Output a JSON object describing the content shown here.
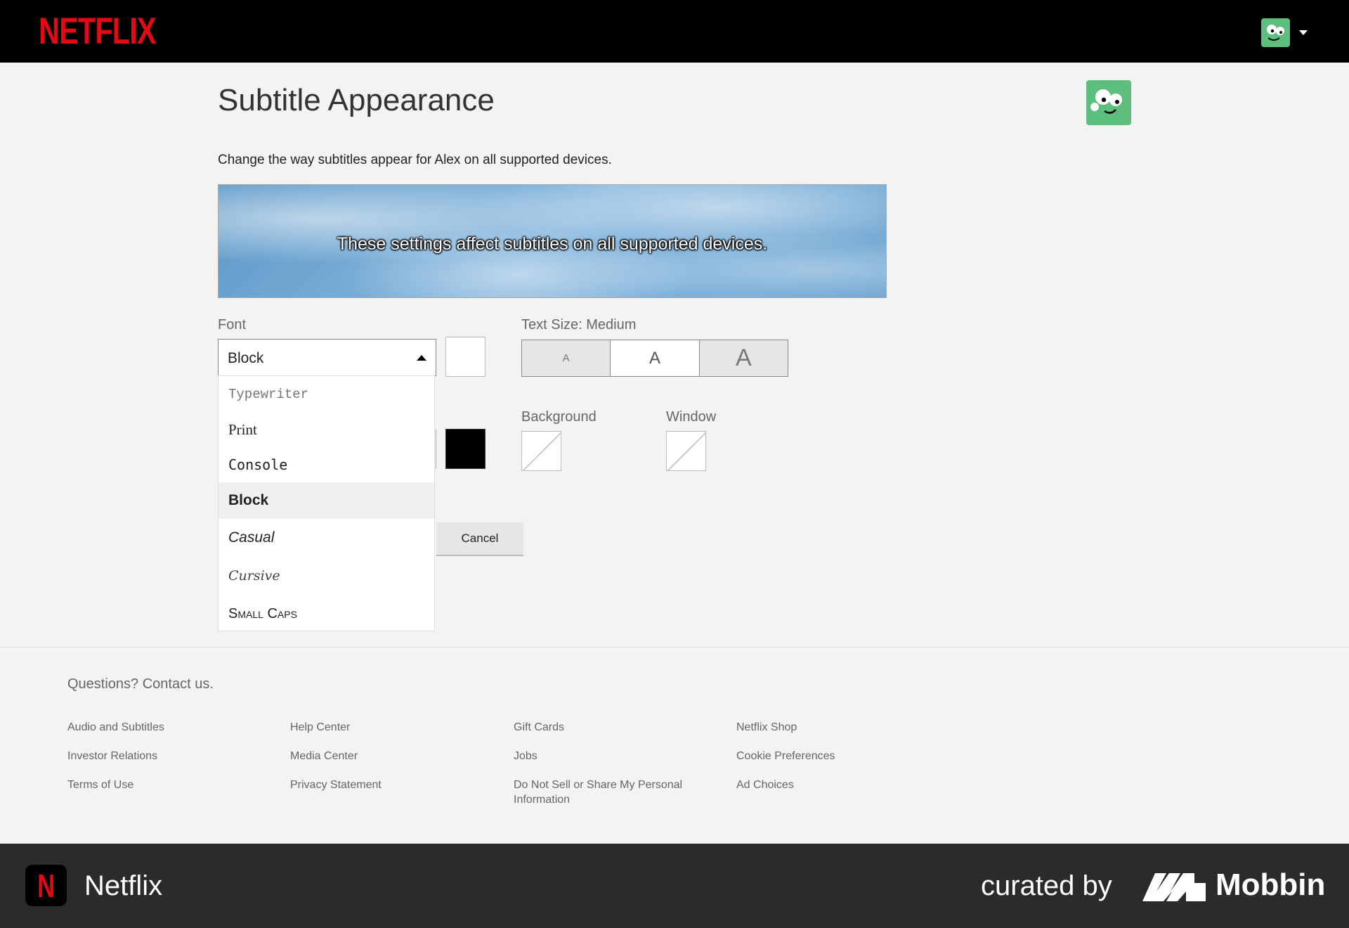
{
  "header": {
    "logo_text": "NETFLIX",
    "brand_color": "#e50914",
    "profile_icon": "profile-avatar-icon",
    "menu_icon": "caret-down-icon"
  },
  "main": {
    "title": "Subtitle Appearance",
    "description": "Change the way subtitles appear for Alex on all supported devices.",
    "preview_text": "These settings affect subtitles on all supported devices.",
    "font_label": "Font",
    "font_value": "Block",
    "text_size_label": "Text Size: Medium",
    "size_options": [
      "A",
      "A",
      "A"
    ],
    "selected_size": "Medium",
    "background_label": "Background",
    "window_label": "Window",
    "font_options": [
      "Typewriter",
      "Print",
      "Console",
      "Block",
      "Casual",
      "Cursive",
      "Small Caps"
    ],
    "highlighted_font": "Block",
    "cancel_label": "Cancel",
    "text_color": "#ffffff",
    "shadow_color": "#000000"
  },
  "footer": {
    "contact": "Questions? Contact us.",
    "links": [
      [
        "Audio and Subtitles",
        "Investor Relations",
        "Terms of Use"
      ],
      [
        "Help Center",
        "Media Center",
        "Privacy Statement"
      ],
      [
        "Gift Cards",
        "Jobs",
        "Do Not Sell or Share My Personal Information"
      ],
      [
        "Netflix Shop",
        "Cookie Preferences",
        "Ad Choices"
      ]
    ]
  },
  "bottom_bar": {
    "app_icon_letter": "N",
    "app_name": "Netflix",
    "curated_by": "curated by",
    "brand": "Mobbin"
  }
}
